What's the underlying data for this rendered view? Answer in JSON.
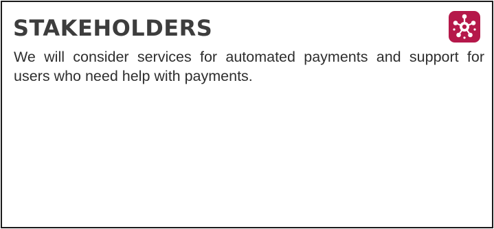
{
  "card": {
    "title": "STAKEHOLDERS",
    "body": "We will consider services for automated payments and support for users who need help with payments.",
    "icon": "stakeholders-network-icon",
    "accent_color": "#b5184a"
  }
}
